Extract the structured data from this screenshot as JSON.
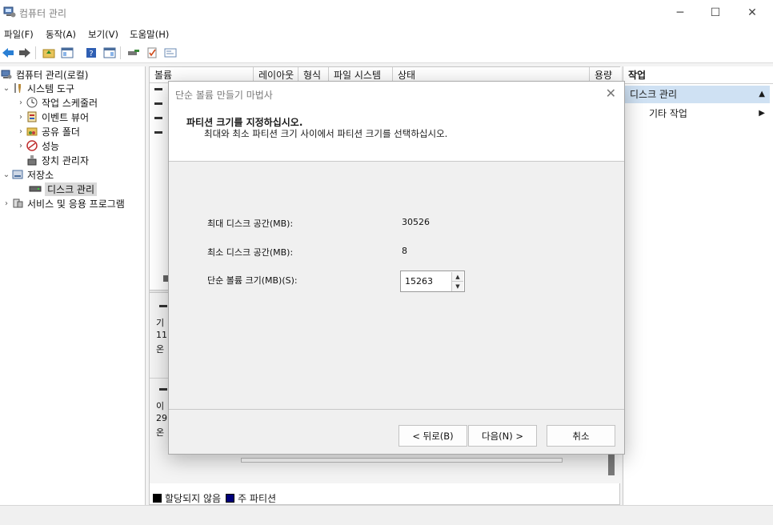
{
  "window": {
    "title": "컴퓨터 관리",
    "minimize_icon": "─",
    "maximize_icon": "☐",
    "close_icon": "✕"
  },
  "menu": [
    "파일(F)",
    "동작(A)",
    "보기(V)",
    "도움말(H)"
  ],
  "tree": {
    "root": "컴퓨터 관리(로컬)",
    "system_tools": "시스템 도구",
    "task_scheduler": "작업 스케줄러",
    "event_viewer": "이벤트 뷰어",
    "shared_folders": "공유 폴더",
    "performance": "성능",
    "device_manager": "장치 관리자",
    "storage": "저장소",
    "disk_management": "디스크 관리",
    "services_apps": "서비스 및 응용 프로그램"
  },
  "volume_table": {
    "columns": [
      "볼륨",
      "레이아웃",
      "형식",
      "파일 시스템",
      "상태",
      "용량"
    ]
  },
  "disk_view": {
    "disk0_lines": [
      "기",
      "11",
      "온"
    ],
    "disk1_lines": [
      "이",
      "29",
      "온"
    ],
    "legend": [
      {
        "label": "할당되지 않음",
        "color": "#000000"
      },
      {
        "label": "주 파티션",
        "color": "#00007a"
      }
    ]
  },
  "actions": {
    "title": "작업",
    "section": "디스크 관리",
    "more_actions": "기타 작업"
  },
  "dialog": {
    "title": "단순 볼륨 만들기 마법사",
    "heading": "파티션 크기를 지정하십시오.",
    "subheading": "최대와 최소 파티션 크기 사이에서 파티션 크기를 선택하십시오.",
    "max_label": "최대 디스크 공간(MB):",
    "max_value": "30526",
    "min_label": "최소 디스크 공간(MB):",
    "min_value": "8",
    "size_label": "단순 볼륨 크기(MB)(S):",
    "size_value": "15263",
    "back_button": "< 뒤로(B)",
    "next_button": "다음(N) >",
    "cancel_button": "취소"
  },
  "colors": {
    "accent_selection": "#cfe1f3",
    "unallocated": "#000000",
    "primary_partition": "#00007a"
  }
}
